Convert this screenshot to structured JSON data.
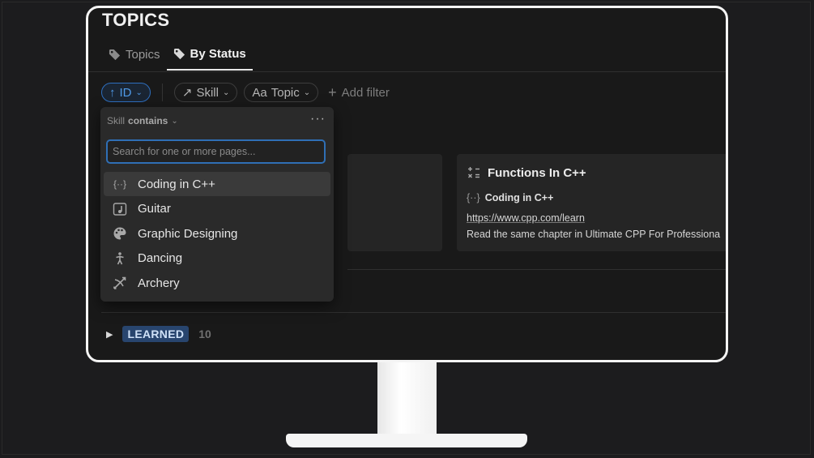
{
  "app": {
    "title": "TOPICS"
  },
  "tabs": [
    {
      "label": "Topics",
      "icon": "tag-icon",
      "active": false
    },
    {
      "label": "By Status",
      "icon": "tag-icon",
      "active": true
    }
  ],
  "filters": {
    "sort": "ID",
    "skill": "Skill",
    "topic_prefix": "Aa",
    "topic": "Topic",
    "add_filter": "Add filter"
  },
  "dropdown": {
    "property": "Skill",
    "operator": "contains",
    "more": "···",
    "search_placeholder": "Search for one or more pages...",
    "options": [
      {
        "label": "Coding in C++",
        "icon": "code-braces-icon"
      },
      {
        "label": "Guitar",
        "icon": "music-note-icon"
      },
      {
        "label": "Graphic Designing",
        "icon": "palette-icon"
      },
      {
        "label": "Dancing",
        "icon": "person-dance-icon"
      },
      {
        "label": "Archery",
        "icon": "bow-arrow-icon"
      }
    ]
  },
  "card": {
    "title": "Functions In C++",
    "skill": "Coding in C++",
    "link": "https://www.cpp.com/learn",
    "note": "Read the same chapter in Ultimate CPP For Professiona"
  },
  "group": {
    "label": "LEARNED",
    "count": "10"
  },
  "colors": {
    "accent": "#2e6fbf",
    "badge": "#28456e",
    "background": "#191919"
  }
}
